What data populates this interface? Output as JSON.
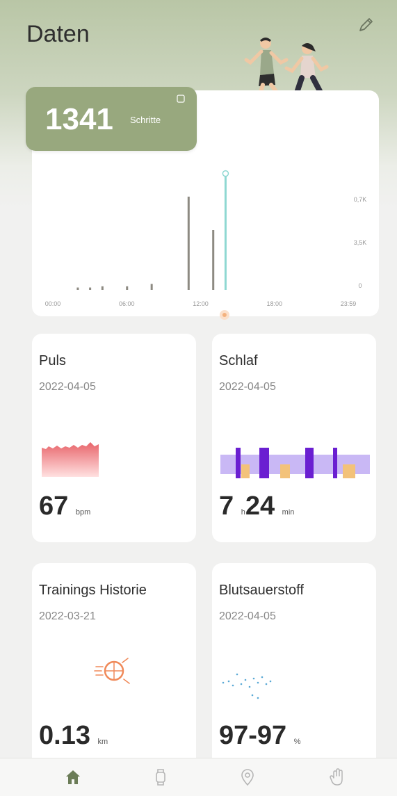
{
  "header": {
    "title": "Daten",
    "edit_icon": "pencil-icon"
  },
  "steps": {
    "value": "1341",
    "unit": "Schritte",
    "accent": "#98a87e",
    "chart_data": {
      "type": "bar",
      "x_ticks": [
        "00:00",
        "06:00",
        "12:00",
        "18:00",
        "23:59"
      ],
      "y_ticks": [
        "0",
        "3,5K",
        "0,7K"
      ],
      "bars": [
        {
          "hour": 2,
          "value": 0.02
        },
        {
          "hour": 3,
          "value": 0.02
        },
        {
          "hour": 4,
          "value": 0.03
        },
        {
          "hour": 6,
          "value": 0.03
        },
        {
          "hour": 8,
          "value": 0.05
        },
        {
          "hour": 11,
          "value": 0.78
        },
        {
          "hour": 13,
          "value": 0.5
        },
        {
          "hour": 14,
          "value": 0.95
        }
      ],
      "selected_hour": 14
    }
  },
  "cards": {
    "puls": {
      "title": "Puls",
      "date": "2022-04-05",
      "value": "67",
      "unit": "bpm",
      "color": "#e8646a"
    },
    "schlaf": {
      "title": "Schlaf",
      "date": "2022-04-05",
      "hours": "7",
      "h_unit": "h",
      "minutes": "24",
      "m_unit": "min",
      "colors": [
        "#6a1fd1",
        "#c9b8f5",
        "#f3c27a"
      ]
    },
    "training": {
      "title": "Trainings Historie",
      "date": "2022-03-21",
      "value": "0.13",
      "unit": "km",
      "color": "#f08a5a"
    },
    "blut": {
      "title": "Blutsauerstoff",
      "date": "2022-04-05",
      "value": "97-97",
      "unit": "%",
      "color": "#5aa9d6"
    }
  },
  "nav": {
    "items": [
      "home-icon",
      "watch-icon",
      "location-icon",
      "hand-icon"
    ],
    "active": "home-icon"
  }
}
